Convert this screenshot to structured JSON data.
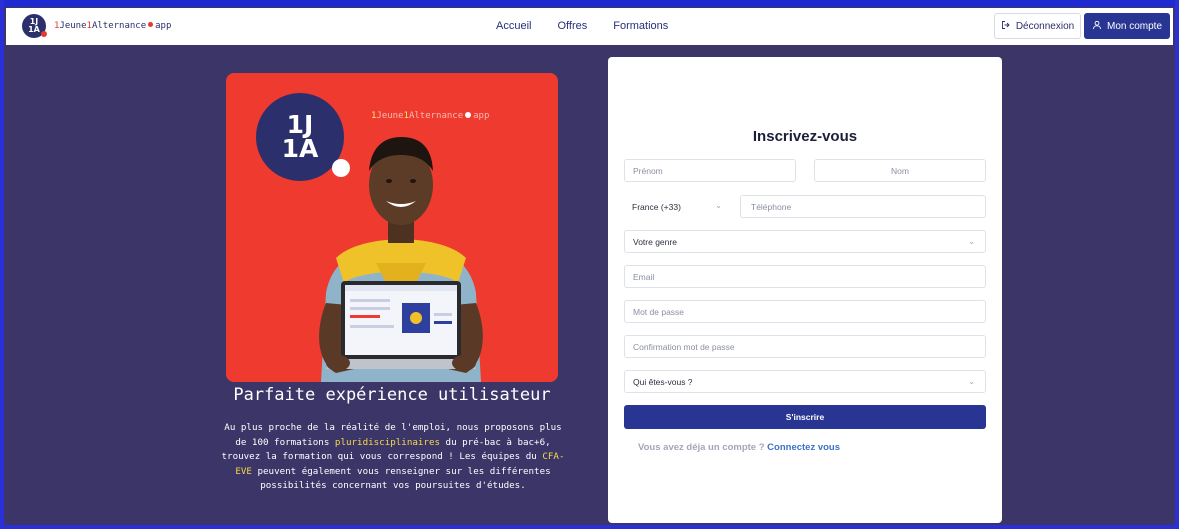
{
  "header": {
    "logo": {
      "line1": "1J",
      "line2": "1A"
    },
    "brand": {
      "p1": "1",
      "p2": "Jeune",
      "p3": "1",
      "p4": "Alternance",
      "p5": "app"
    },
    "nav": [
      "Accueil",
      "Offres",
      "Formations"
    ],
    "logout_icon": "logout-icon",
    "logout_label": "Déconnexion",
    "account_icon": "user-icon",
    "account_label": "Mon compte"
  },
  "promo": {
    "logo": {
      "line1": "1J",
      "line2": "1A"
    },
    "brand": {
      "p1": "1",
      "p2": "Jeune",
      "p3": "1",
      "p4": "Alternance",
      "p5": "app"
    },
    "title": "Parfaite expérience utilisateur",
    "text": {
      "t1": "Au plus proche de la réalité de l'emploi, nous proposons plus de 100 formations ",
      "h1": "pluridisciplinaires",
      "t2": " du pré-bac à bac+6, trouvez la formation qui vous correspond ! Les équipes du ",
      "h2": "CFA-EVE",
      "t3": " peuvent également vous renseigner sur les différentes possibilités concernant vos poursuites d'études."
    },
    "colors": {
      "card": "#ef3a2f",
      "highlight": "#f7d94c",
      "background": "#3b3568"
    }
  },
  "form": {
    "title": "Inscrivez-vous",
    "prenom_placeholder": "Prénom",
    "nom_placeholder": "Nom",
    "country_value": "France (+33)",
    "tel_placeholder": "Téléphone",
    "genre_value": "Votre genre",
    "email_placeholder": "Email",
    "password_placeholder": "Mot de passe",
    "confirm_placeholder": "Confirmation mot de passe",
    "qui_value": "Qui êtes-vous ?",
    "submit_label": "S'inscrire",
    "login_prompt": "Vous avez déja un compte ?",
    "login_link": "Connectez vous",
    "accent": "#283593"
  }
}
